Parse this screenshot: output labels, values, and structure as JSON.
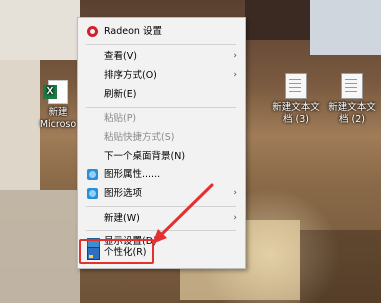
{
  "desktop": {
    "icons": [
      {
        "label_line1": "新建",
        "label_line2": "Microso"
      },
      {
        "label_line1": "新建文本文",
        "label_line2": "档 (3)"
      },
      {
        "label_line1": "新建文本文",
        "label_line2": "档 (2)"
      }
    ]
  },
  "context_menu": {
    "items": [
      {
        "label": "Radeon 设置",
        "icon": "radeon-icon",
        "enabled": true,
        "submenu": false
      },
      {
        "label": "查看(V)",
        "enabled": true,
        "submenu": true
      },
      {
        "label": "排序方式(O)",
        "enabled": true,
        "submenu": true
      },
      {
        "label": "刷新(E)",
        "enabled": true,
        "submenu": false
      },
      {
        "label": "粘贴(P)",
        "enabled": false,
        "submenu": false
      },
      {
        "label": "粘贴快捷方式(S)",
        "enabled": false,
        "submenu": false
      },
      {
        "label": "下一个桌面背景(N)",
        "enabled": true,
        "submenu": false
      },
      {
        "label": "图形属性......",
        "icon": "graphics-properties-icon",
        "enabled": true,
        "submenu": false
      },
      {
        "label": "图形选项",
        "icon": "graphics-options-icon",
        "enabled": true,
        "submenu": true
      },
      {
        "label": "新建(W)",
        "enabled": true,
        "submenu": true
      },
      {
        "label": "显示设置(D)",
        "icon": "display-icon",
        "enabled": true,
        "submenu": false
      },
      {
        "label": "个性化(R)",
        "icon": "personalize-icon",
        "enabled": true,
        "submenu": false
      }
    ],
    "submenu_arrow": "›"
  },
  "annotation": {
    "color": "#e53030",
    "target": "个性化(R)"
  }
}
